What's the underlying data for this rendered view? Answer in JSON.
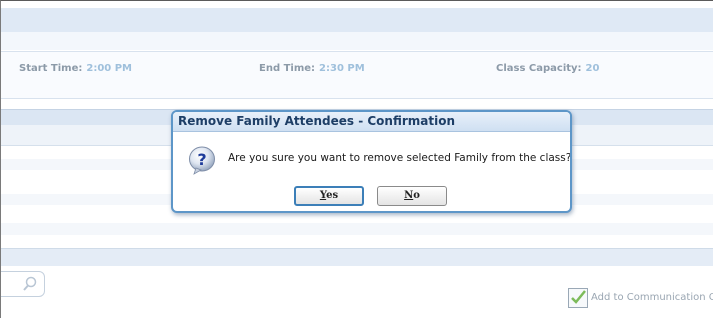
{
  "class_info": {
    "start_time_label": "Start Time:",
    "start_time_value": "2:00 PM",
    "end_time_label": "End Time:",
    "end_time_value": "2:30 PM",
    "capacity_label": "Class Capacity:",
    "capacity_value": "20"
  },
  "footer": {
    "communication_label": "Add to Communication Qu"
  },
  "dialog": {
    "title": "Remove Family Attendees - Confirmation",
    "message": "Are you sure you want to remove selected Family from the class?",
    "icon": "question-icon",
    "yes_hotkey": "Y",
    "yes_rest": "es",
    "no_hotkey": "N",
    "no_rest": "o"
  },
  "colors": {
    "dialog_border": "#5d96c8",
    "title_text": "#1d3e66"
  }
}
